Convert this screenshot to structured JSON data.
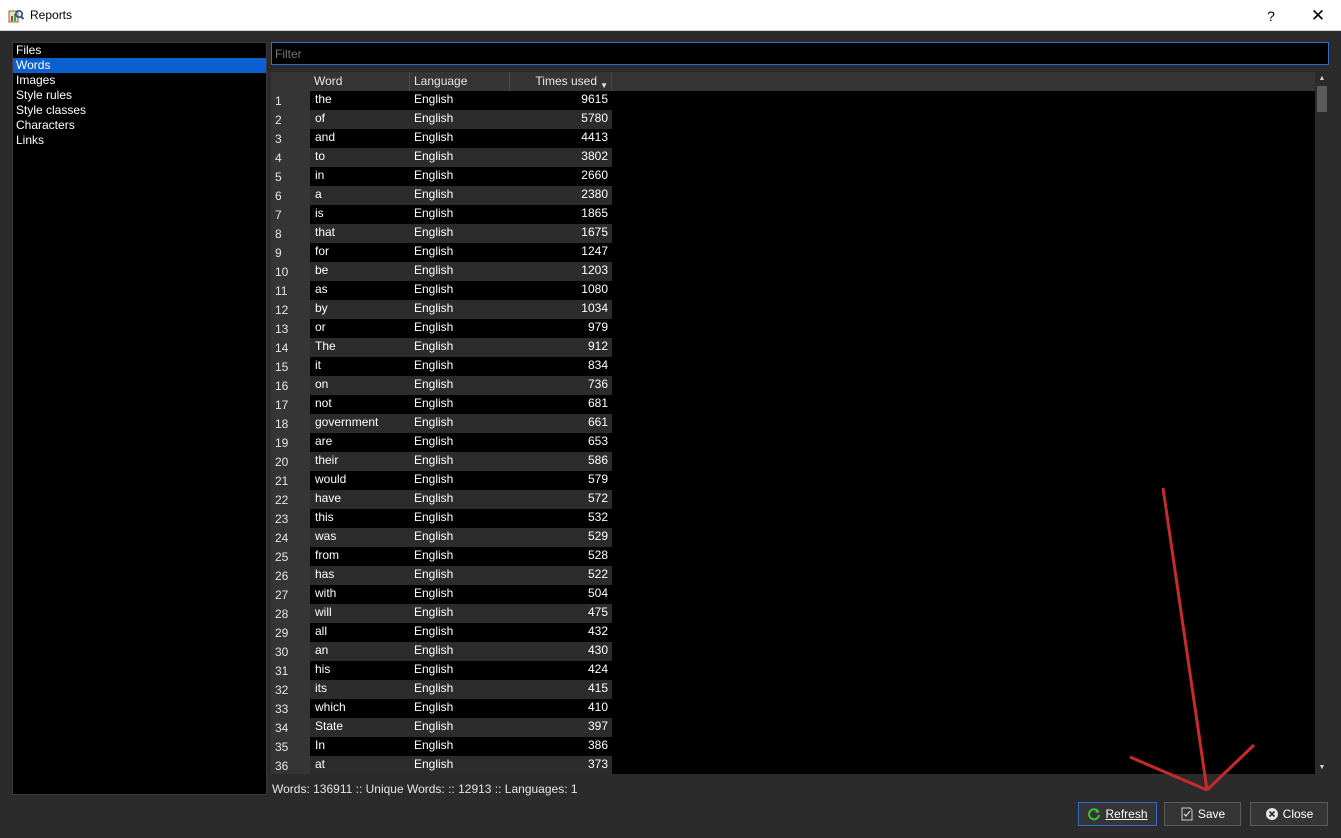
{
  "window": {
    "title": "Reports",
    "help_label": "?",
    "close_label": "✕",
    "icon": "reports-app-icon"
  },
  "nav": {
    "items": [
      {
        "label": "Files",
        "selected": false
      },
      {
        "label": "Words",
        "selected": true
      },
      {
        "label": "Images",
        "selected": false
      },
      {
        "label": "Style rules",
        "selected": false
      },
      {
        "label": "Style classes",
        "selected": false
      },
      {
        "label": "Characters",
        "selected": false
      },
      {
        "label": "Links",
        "selected": false
      }
    ]
  },
  "filter": {
    "placeholder": "Filter",
    "value": ""
  },
  "table": {
    "headers": {
      "word": "Word",
      "language": "Language",
      "times_used": "Times used"
    },
    "sort": {
      "column": "times_used",
      "direction": "descending"
    },
    "rows": [
      {
        "n": "1",
        "word": "the",
        "language": "English",
        "times": "9615"
      },
      {
        "n": "2",
        "word": "of",
        "language": "English",
        "times": "5780"
      },
      {
        "n": "3",
        "word": "and",
        "language": "English",
        "times": "4413"
      },
      {
        "n": "4",
        "word": "to",
        "language": "English",
        "times": "3802"
      },
      {
        "n": "5",
        "word": "in",
        "language": "English",
        "times": "2660"
      },
      {
        "n": "6",
        "word": "a",
        "language": "English",
        "times": "2380"
      },
      {
        "n": "7",
        "word": "is",
        "language": "English",
        "times": "1865"
      },
      {
        "n": "8",
        "word": "that",
        "language": "English",
        "times": "1675"
      },
      {
        "n": "9",
        "word": "for",
        "language": "English",
        "times": "1247"
      },
      {
        "n": "10",
        "word": "be",
        "language": "English",
        "times": "1203"
      },
      {
        "n": "11",
        "word": "as",
        "language": "English",
        "times": "1080"
      },
      {
        "n": "12",
        "word": "by",
        "language": "English",
        "times": "1034"
      },
      {
        "n": "13",
        "word": "or",
        "language": "English",
        "times": "979"
      },
      {
        "n": "14",
        "word": "The",
        "language": "English",
        "times": "912"
      },
      {
        "n": "15",
        "word": "it",
        "language": "English",
        "times": "834"
      },
      {
        "n": "16",
        "word": "on",
        "language": "English",
        "times": "736"
      },
      {
        "n": "17",
        "word": "not",
        "language": "English",
        "times": "681"
      },
      {
        "n": "18",
        "word": "government",
        "language": "English",
        "times": "661"
      },
      {
        "n": "19",
        "word": "are",
        "language": "English",
        "times": "653"
      },
      {
        "n": "20",
        "word": "their",
        "language": "English",
        "times": "586"
      },
      {
        "n": "21",
        "word": "would",
        "language": "English",
        "times": "579"
      },
      {
        "n": "22",
        "word": "have",
        "language": "English",
        "times": "572"
      },
      {
        "n": "23",
        "word": "this",
        "language": "English",
        "times": "532"
      },
      {
        "n": "24",
        "word": "was",
        "language": "English",
        "times": "529"
      },
      {
        "n": "25",
        "word": "from",
        "language": "English",
        "times": "528"
      },
      {
        "n": "26",
        "word": "has",
        "language": "English",
        "times": "522"
      },
      {
        "n": "27",
        "word": "with",
        "language": "English",
        "times": "504"
      },
      {
        "n": "28",
        "word": "will",
        "language": "English",
        "times": "475"
      },
      {
        "n": "29",
        "word": "all",
        "language": "English",
        "times": "432"
      },
      {
        "n": "30",
        "word": "an",
        "language": "English",
        "times": "430"
      },
      {
        "n": "31",
        "word": "his",
        "language": "English",
        "times": "424"
      },
      {
        "n": "32",
        "word": "its",
        "language": "English",
        "times": "415"
      },
      {
        "n": "33",
        "word": "which",
        "language": "English",
        "times": "410"
      },
      {
        "n": "34",
        "word": "State",
        "language": "English",
        "times": "397"
      },
      {
        "n": "35",
        "word": "In",
        "language": "English",
        "times": "386"
      },
      {
        "n": "36",
        "word": "at",
        "language": "English",
        "times": "373"
      }
    ]
  },
  "status": {
    "text": "Words: 136911 :: Unique Words: :: 12913 :: Languages: 1"
  },
  "buttons": {
    "refresh": "Refresh",
    "save": "Save",
    "close": "Close"
  },
  "colors": {
    "accent": "#0a5fd1",
    "focus_border": "#2f6ad6",
    "annotation_arrow": "#c62b2b"
  }
}
